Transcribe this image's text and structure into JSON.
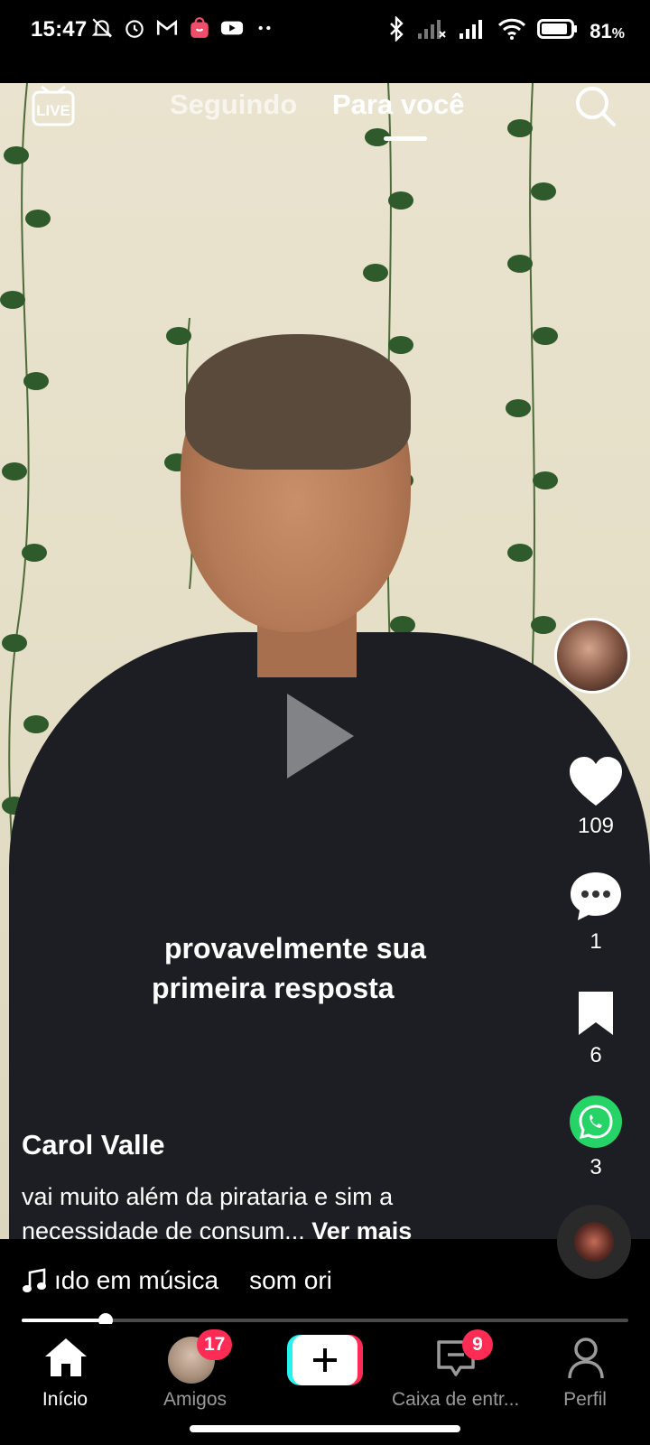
{
  "status_bar": {
    "time": "15:47",
    "battery": "81",
    "battery_unit": "%",
    "left_icons": [
      "mute-bell-icon",
      "alarm-icon",
      "gmail-icon",
      "shopping-bag-icon",
      "youtube-icon",
      "more-dots-icon"
    ],
    "right_icons": [
      "bluetooth-icon",
      "signal-off-icon",
      "signal-icon",
      "wifi-icon",
      "battery-icon"
    ]
  },
  "top_nav": {
    "live_label": "LIVE",
    "tabs": [
      {
        "label": "Seguindo",
        "active": false
      },
      {
        "label": "Para você",
        "active": true
      }
    ]
  },
  "right_rail": {
    "likes": "109",
    "comments": "1",
    "saves": "6",
    "shares": "3"
  },
  "video": {
    "overlay_line1": "provavelmente sua",
    "overlay_line2": "primeira resposta",
    "username": "Carol Valle",
    "description": "vai muito além da pirataria e sim a necessidade de consum...",
    "more_label": "Ver mais",
    "music_part1": "ıdo em música",
    "music_part2": "som ori",
    "progress_fraction": 0.138
  },
  "bottom_nav": {
    "items": [
      {
        "label": "Início",
        "active": true
      },
      {
        "label": "Amigos",
        "badge": "17"
      },
      {
        "label": "",
        "type": "create"
      },
      {
        "label": "Caixa de entr...",
        "badge": "9"
      },
      {
        "label": "Perfil"
      }
    ]
  },
  "colors": {
    "accent_red": "#fe2c55",
    "accent_cyan": "#25f4ee",
    "whatsapp_green": "#25d366"
  }
}
